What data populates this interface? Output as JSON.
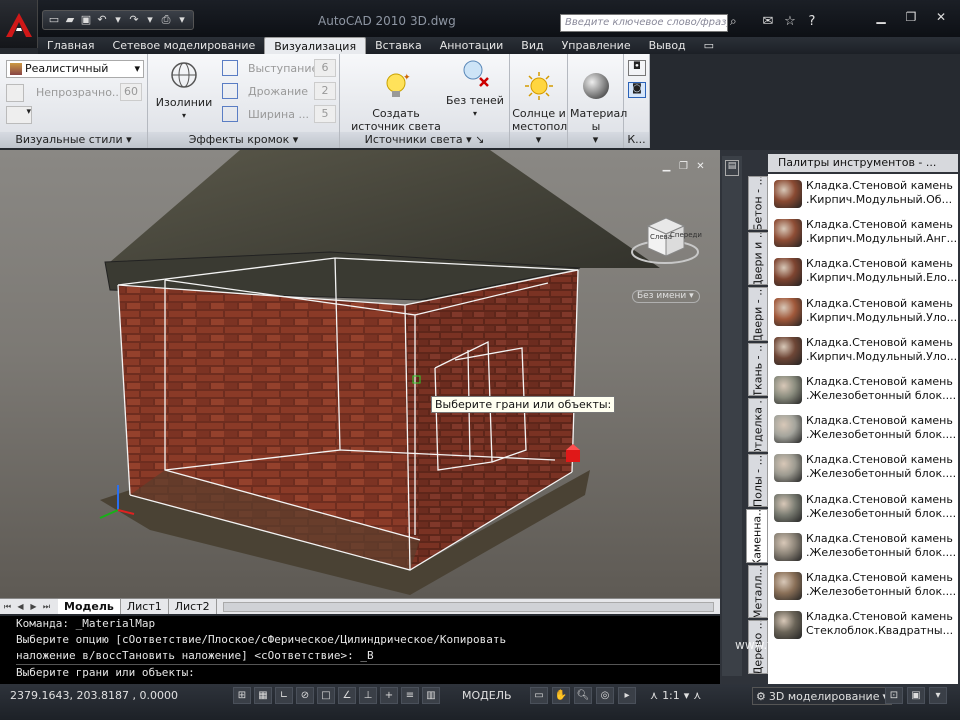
{
  "titlebar": {
    "app_title": "AutoCAD 2010",
    "doc_title": "3D.dwg",
    "search_placeholder": "Введите ключевое слово/фразу"
  },
  "ribbon_tabs": [
    "Главная",
    "Сетевое моделирование",
    "Визуализация",
    "Вставка",
    "Аннотации",
    "Вид",
    "Управление",
    "Вывод"
  ],
  "active_tab": "Визуализация",
  "ribbon": {
    "visual_styles": {
      "style_value": "Реалистичный",
      "opacity_label": "Непрозрачно...",
      "opacity_value": "60",
      "panel_label": "Визуальные стили"
    },
    "edge_effects": {
      "isolines_label": "Изолинии",
      "overhang_label": "Выступание",
      "overhang_value": "6",
      "jitter_label": "Дрожание",
      "jitter_value": "2",
      "width_label": "Ширина ...",
      "width_value": "5",
      "panel_label": "Эффекты кромок"
    },
    "lights": {
      "create_light": "Создать\nисточник света",
      "no_shadows": "Без теней",
      "panel_label": "Источники света"
    },
    "sun": {
      "label": "Солнце и\nместопол\nожение"
    },
    "materials": {
      "label": "Материал\nы"
    },
    "camera": {
      "panel_label": "К..."
    }
  },
  "viewport": {
    "named_view": "Без имени",
    "tooltip": "Выберите грани или объекты:",
    "viewcube": {
      "left": "Слева",
      "front": "Спереди"
    }
  },
  "layout_tabs": [
    "Модель",
    "Лист1",
    "Лист2"
  ],
  "active_layout": "Модель",
  "command": {
    "lines": [
      "Команда: _MaterialMap",
      "Выберите опцию [сОответствие/Плоское/сФерическое/Цилиндрическое/Копировать",
      "наложение в/воссТановить наложение] <сОответствие>: _B"
    ],
    "prompt": "Выберите грани или объекты:"
  },
  "status": {
    "coords": "2379.1643,  203.8187 , 0.0000",
    "model": "МОДЕЛЬ",
    "scale": "1:1",
    "workspace": "3D моделирование"
  },
  "palette": {
    "title": "Палитры инструментов - ...",
    "tabs": [
      "Бетон - ...",
      "Двери и ...",
      "Двери - ...",
      "Ткань - ...",
      "Отделка ...",
      "Полы - ...",
      "Каменна...",
      "Металл...",
      "Дерево ..."
    ],
    "active_tab": "Каменна...",
    "materials": [
      {
        "line1": "Кладка.Стеновой камень",
        "line2": ".Кирпич.Модульный.Об...",
        "swatch": "#8a4a32"
      },
      {
        "line1": "Кладка.Стеновой камень",
        "line2": ".Кирпич.Модульный.Анг...",
        "swatch": "#8e4d35"
      },
      {
        "line1": "Кладка.Стеновой камень",
        "line2": ".Кирпич.Модульный.Ело...",
        "swatch": "#7e4430"
      },
      {
        "line1": "Кладка.Стеновой камень",
        "line2": ".Кирпич.Модульный.Уло...",
        "swatch": "#a0583a"
      },
      {
        "line1": "Кладка.Стеновой камень",
        "line2": ".Кирпич.Модульный.Уло...",
        "swatch": "#6e4636"
      },
      {
        "line1": "Кладка.Стеновой камень",
        "line2": ".Железобетонный блок....",
        "swatch": "#8a8c7e"
      },
      {
        "line1": "Кладка.Стеновой камень",
        "line2": ".Железобетонный блок....",
        "swatch": "#a4a49c"
      },
      {
        "line1": "Кладка.Стеновой камень",
        "line2": ".Железобетонный блок....",
        "swatch": "#9c9a90"
      },
      {
        "line1": "Кладка.Стеновой камень",
        "line2": ".Железобетонный блок....",
        "swatch": "#7a7c72"
      },
      {
        "line1": "Кладка.Стеновой камень",
        "line2": ".Железобетонный блок....",
        "swatch": "#8c8478"
      },
      {
        "line1": "Кладка.Стеновой камень",
        "line2": ".Железобетонный блок....",
        "swatch": "#8a7058"
      },
      {
        "line1": "Кладка.Стеновой камень",
        "line2": "Стеклоблок.Квадратны...",
        "swatch": "#6a6458"
      }
    ]
  },
  "watermark": "www.teachvideo.ru"
}
